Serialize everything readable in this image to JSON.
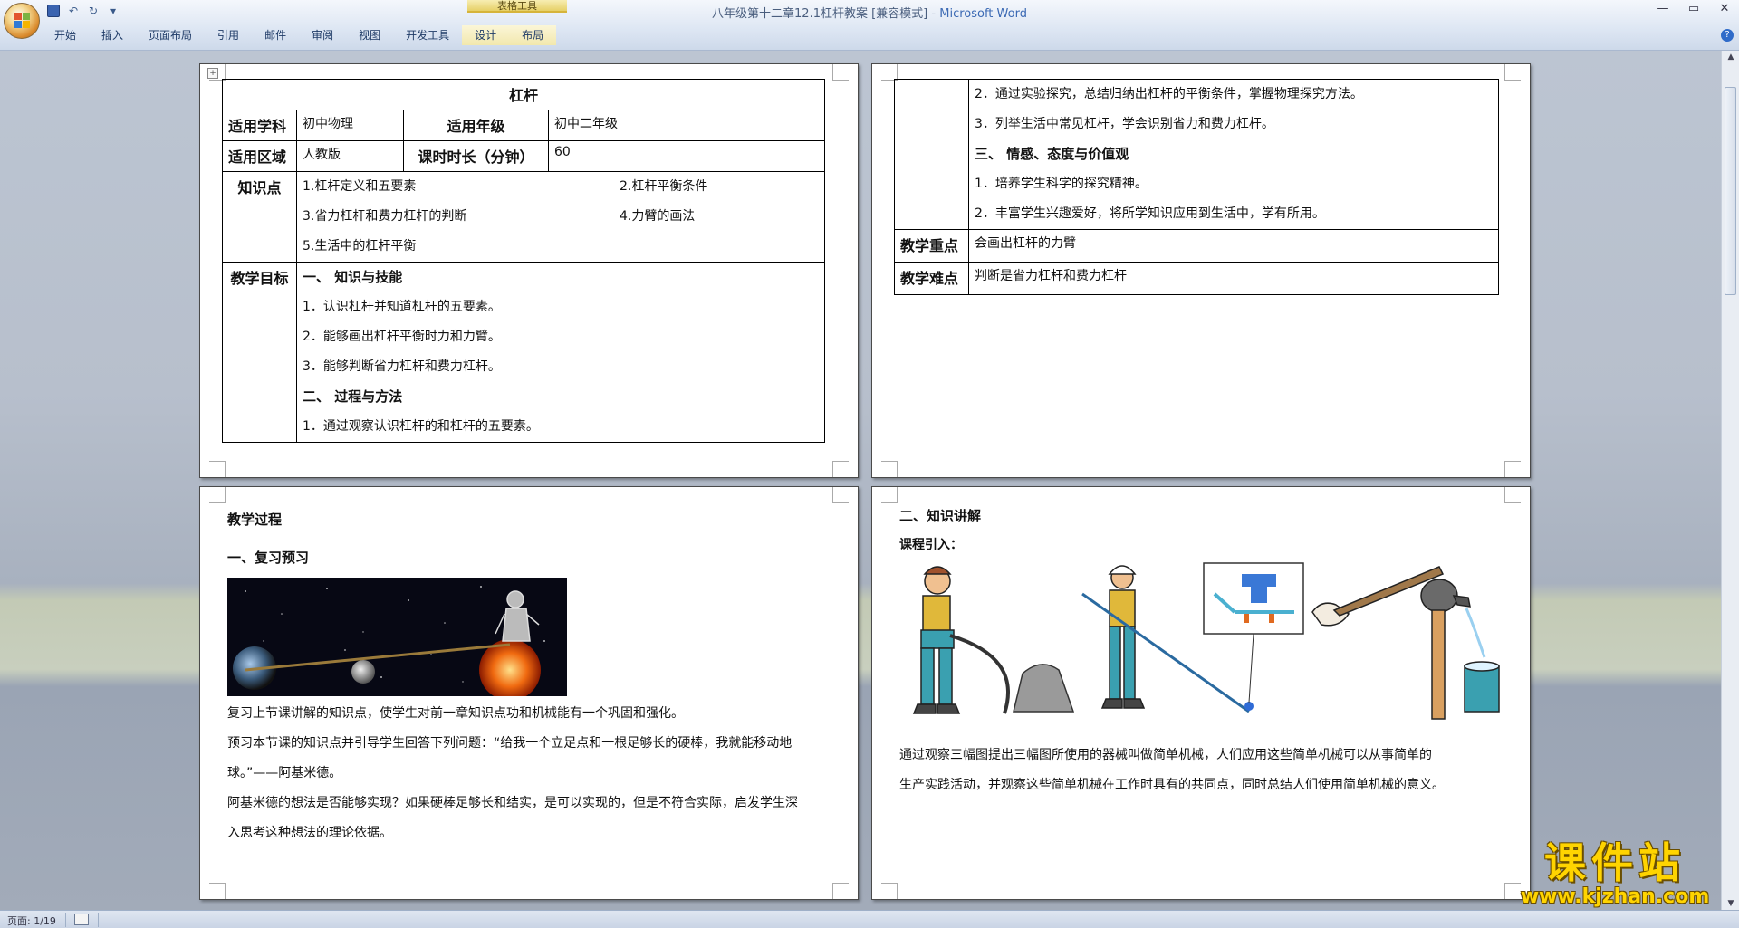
{
  "window": {
    "doc_title": "八年级第十二章12.1杠杆教案 [兼容模式]",
    "separator": " - ",
    "app_name": "Microsoft Word",
    "context_group": "表格工具",
    "controls": [
      "—",
      "▭",
      "✕"
    ]
  },
  "ribbon": {
    "tabs": [
      "开始",
      "插入",
      "页面布局",
      "引用",
      "邮件",
      "审阅",
      "视图",
      "开发工具",
      "设计",
      "布局"
    ],
    "help": "?"
  },
  "page1": {
    "table_title": "杠杆",
    "row1": {
      "l1": "适用学科",
      "v1": "初中物理",
      "l2": "适用年级",
      "v2": "初中二年级"
    },
    "row2": {
      "l1": "适用区域",
      "v1": "人教版",
      "l2": "课时时长（分钟）",
      "v2": "60"
    },
    "knowledge": {
      "label": "知识点",
      "items": [
        "1.杠杆定义和五要素",
        "2.杠杆平衡条件",
        "3.省力杠杆和费力杠杆的判断",
        "4.力臂的画法",
        "5.生活中的杠杆平衡"
      ]
    },
    "goals": {
      "label": "教学目标",
      "lines": [
        "一、  知识与技能",
        "1．认识杠杆并知道杠杆的五要素。",
        "2．能够画出杠杆平衡时力和力臂。",
        "3．能够判断省力杠杆和费力杠杆。",
        "二、  过程与方法",
        "1．通过观察认识杠杆的和杠杆的五要素。"
      ]
    }
  },
  "page2": {
    "goal_lines": [
      "2．通过实验探究，总结归纳出杠杆的平衡条件，掌握物理探究方法。",
      "3．列举生活中常见杠杆，学会识别省力和费力杠杆。",
      "三、  情感、态度与价值观",
      "1．培养学生科学的探究精神。",
      "2．丰富学生兴趣爱好，将所学知识应用到生活中，学有所用。"
    ],
    "key_label": "教学重点",
    "key_value": "会画出杠杆的力臂",
    "diff_label": "教学难点",
    "diff_value": "判断是省力杠杆和费力杠杆"
  },
  "page3": {
    "heading": "教学过程",
    "subheading": "一、复习预习",
    "paragraphs": [
      "复习上节课讲解的知识点，使学生对前一章知识点功和机械能有一个巩固和强化。",
      "预习本节课的知识点并引导学生回答下列问题：“给我一个立足点和一根足够长的硬棒，我就能移动地",
      "球。”——阿基米德。",
      "阿基米德的想法是否能够实现？如果硬棒足够长和结实，是可以实现的，但是不符合实际，启发学生深",
      "入思考这种想法的理论依据。"
    ]
  },
  "page4": {
    "heading": "二、知识讲解",
    "subheading": "课程引入：",
    "paragraphs": [
      "通过观察三幅图提出三幅图所使用的器械叫做简单机械，人们应用这些简单机械可以从事简单的",
      "生产实践活动，并观察这些简单机械在工作时具有的共同点，同时总结人们使用简单机械的意义。"
    ]
  },
  "status": {
    "page": "页面: 1/19"
  },
  "watermark": {
    "cn": "课件站",
    "url": "www.kjzhan.com"
  },
  "colors": {
    "ribbon_text": "#1e3a66",
    "app_name": "#3c6ab4",
    "watermark": "#ffd400"
  }
}
